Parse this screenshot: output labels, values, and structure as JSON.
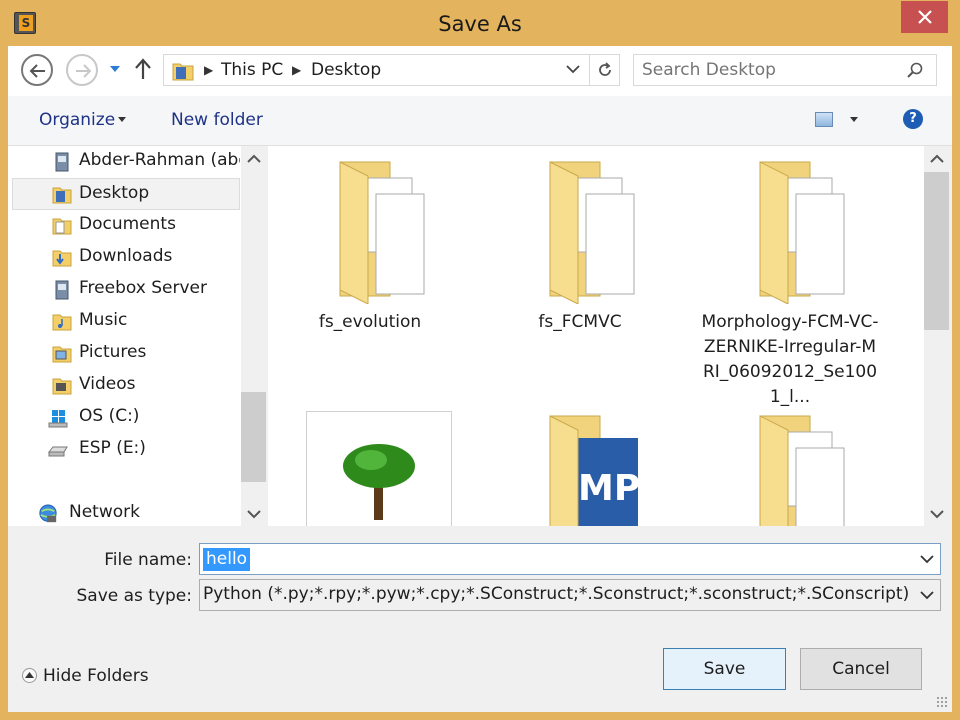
{
  "window": {
    "title": "Save As"
  },
  "nav": {
    "breadcrumbs": [
      "This PC",
      "Desktop"
    ],
    "search_placeholder": "Search Desktop"
  },
  "toolbar": {
    "organize": "Organize",
    "new_folder": "New folder"
  },
  "tree": [
    {
      "label": "Abder-Rahman (abd",
      "icon": "user-folder-icon"
    },
    {
      "label": "Desktop",
      "icon": "desktop-folder-icon",
      "selected": true
    },
    {
      "label": "Documents",
      "icon": "documents-folder-icon"
    },
    {
      "label": "Downloads",
      "icon": "downloads-folder-icon"
    },
    {
      "label": "Freebox Server",
      "icon": "server-icon"
    },
    {
      "label": "Music",
      "icon": "music-folder-icon"
    },
    {
      "label": "Pictures",
      "icon": "pictures-folder-icon"
    },
    {
      "label": "Videos",
      "icon": "videos-folder-icon"
    },
    {
      "label": "OS (C:)",
      "icon": "windows-drive-icon"
    },
    {
      "label": "ESP (E:)",
      "icon": "drive-icon"
    },
    {
      "label": "Network",
      "icon": "network-icon"
    }
  ],
  "files": [
    {
      "label": "fs_evolution",
      "icon": "folder-icon"
    },
    {
      "label": "fs_FCMVC",
      "icon": "folder-icon"
    },
    {
      "label": "Morphology-FCM-VC-ZERNIKE-Irregular-MRI_06092012_Se1001_l...",
      "icon": "folder-icon"
    },
    {
      "label": "",
      "icon": "tree-image-icon"
    },
    {
      "label": "",
      "icon": "mp-folder-icon"
    },
    {
      "label": "",
      "icon": "folder-icon"
    }
  ],
  "form": {
    "file_name_label": "File name:",
    "file_name_value": "hello",
    "save_type_label": "Save as type:",
    "save_type_value": "Python (*.py;*.rpy;*.pyw;*.cpy;*.SConstruct;*.Sconstruct;*.sconstruct;*.SConscript)"
  },
  "footer": {
    "hide_folders": "Hide Folders",
    "save": "Save",
    "cancel": "Cancel"
  },
  "colors": {
    "frame": "#e3b35e",
    "close": "#c75050",
    "accent": "#3399ff"
  }
}
